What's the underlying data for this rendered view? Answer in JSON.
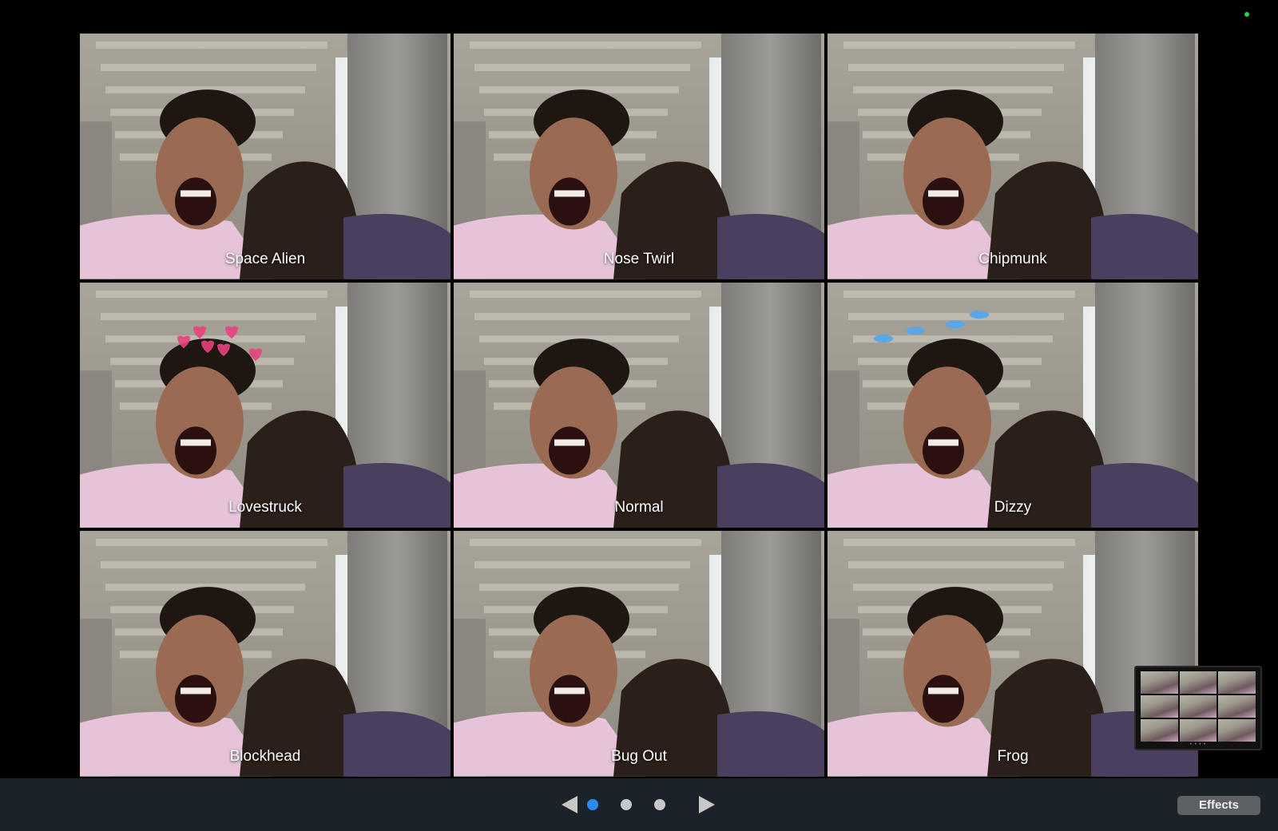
{
  "effects": [
    {
      "label": "Space Alien",
      "overlay": ""
    },
    {
      "label": "Nose Twirl",
      "overlay": ""
    },
    {
      "label": "Chipmunk",
      "overlay": ""
    },
    {
      "label": "Lovestruck",
      "overlay": "hearts"
    },
    {
      "label": "Normal",
      "overlay": ""
    },
    {
      "label": "Dizzy",
      "overlay": "birds"
    },
    {
      "label": "Blockhead",
      "overlay": ""
    },
    {
      "label": "Bug Out",
      "overlay": ""
    },
    {
      "label": "Frog",
      "overlay": ""
    }
  ],
  "pager": {
    "page_count": 3,
    "active_page": 1
  },
  "effects_button": {
    "label": "Effects"
  },
  "colors": {
    "active_dot": "#2d8cf0",
    "inactive_dot": "#c8c8c8",
    "camera_indicator": "#2bd04a",
    "bottom_bar": "#1c2328"
  }
}
